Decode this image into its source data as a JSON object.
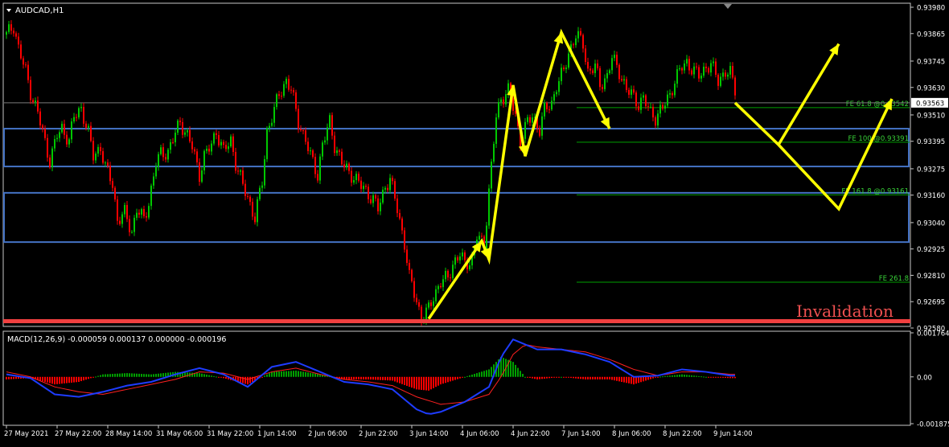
{
  "window": {
    "symbol_label": "AUDCAD,H1"
  },
  "annotations": {
    "invalidation_label": "Invalidation",
    "fib_levels": [
      {
        "label": "FE 61.8 @0.93542",
        "price": 0.93542
      },
      {
        "label": "FE 100 @0.93391",
        "price": 0.93391
      },
      {
        "label": "FE 161.8 @0.93161",
        "price": 0.93161
      },
      {
        "label": "FE 261.8",
        "price": 0.9278
      }
    ],
    "zones": [
      {
        "name": "upper-demand-zone",
        "top": 0.9345,
        "bottom": 0.93285
      },
      {
        "name": "lower-demand-zone",
        "top": 0.9317,
        "bottom": 0.92955
      }
    ],
    "invalidation_price": 0.92615,
    "current_price_label": "0.93563",
    "current_price": 0.93563,
    "colors": {
      "bull": "#00c800",
      "bear": "#ff0000",
      "zone": "#4472c4",
      "projection": "#ffff00",
      "fib": "#00a000",
      "invalidation": "#f04040",
      "macd_line": "#1e3cff",
      "signal_line": "#ff2020"
    }
  },
  "chart_data": [
    {
      "type": "candlestick",
      "symbol": "AUDCAD",
      "timeframe": "H1",
      "ylim": [
        0.9258,
        0.9398
      ],
      "yticks": [
        0.9398,
        0.93865,
        0.93745,
        0.9363,
        0.9351,
        0.93395,
        0.93275,
        0.9316,
        0.9304,
        0.92925,
        0.9281,
        0.92695,
        0.9258
      ],
      "ytick_labels": [
        "0.93980",
        "0.93865",
        "0.93745",
        "0.93630",
        "0.93510",
        "0.93395",
        "0.93275",
        "0.93160",
        "0.93040",
        "0.92925",
        "0.92810",
        "0.92695",
        "0.92580"
      ],
      "close_path": [
        [
          0,
          0.9386
        ],
        [
          3,
          0.939
        ],
        [
          5,
          0.938
        ],
        [
          8,
          0.937
        ],
        [
          10,
          0.9361
        ],
        [
          13,
          0.9352
        ],
        [
          16,
          0.9339
        ],
        [
          18,
          0.9331
        ],
        [
          21,
          0.9342
        ],
        [
          23,
          0.9345
        ],
        [
          26,
          0.934
        ],
        [
          28,
          0.935
        ],
        [
          31,
          0.9354
        ],
        [
          34,
          0.9343
        ],
        [
          36,
          0.9333
        ],
        [
          39,
          0.9337
        ],
        [
          41,
          0.9328
        ],
        [
          44,
          0.9321
        ],
        [
          46,
          0.9305
        ],
        [
          49,
          0.9308
        ],
        [
          52,
          0.93
        ],
        [
          54,
          0.931
        ],
        [
          57,
          0.9305
        ],
        [
          59,
          0.9313
        ],
        [
          62,
          0.933
        ],
        [
          64,
          0.9334
        ],
        [
          67,
          0.9335
        ],
        [
          70,
          0.9343
        ],
        [
          72,
          0.9348
        ],
        [
          75,
          0.9342
        ],
        [
          77,
          0.9337
        ],
        [
          80,
          0.9325
        ],
        [
          82,
          0.9333
        ],
        [
          85,
          0.9338
        ],
        [
          87,
          0.9344
        ],
        [
          90,
          0.9335
        ],
        [
          93,
          0.934
        ],
        [
          95,
          0.933
        ],
        [
          98,
          0.932
        ],
        [
          100,
          0.9315
        ],
        [
          103,
          0.9306
        ],
        [
          106,
          0.9322
        ],
        [
          108,
          0.9344
        ],
        [
          111,
          0.9353
        ],
        [
          113,
          0.936
        ],
        [
          116,
          0.9366
        ],
        [
          118,
          0.9362
        ],
        [
          121,
          0.9348
        ],
        [
          124,
          0.934
        ],
        [
          126,
          0.9333
        ],
        [
          129,
          0.9325
        ],
        [
          131,
          0.9338
        ],
        [
          134,
          0.9348
        ],
        [
          136,
          0.9338
        ],
        [
          139,
          0.933
        ],
        [
          142,
          0.9326
        ],
        [
          144,
          0.9324
        ],
        [
          147,
          0.932
        ],
        [
          149,
          0.9318
        ],
        [
          152,
          0.9314
        ],
        [
          154,
          0.931
        ],
        [
          157,
          0.932
        ],
        [
          159,
          0.9323
        ],
        [
          162,
          0.931
        ],
        [
          165,
          0.9295
        ],
        [
          167,
          0.928
        ],
        [
          170,
          0.927
        ],
        [
          172,
          0.9262
        ],
        [
          175,
          0.9266
        ],
        [
          177,
          0.9272
        ],
        [
          180,
          0.9278
        ],
        [
          183,
          0.928
        ],
        [
          185,
          0.9286
        ],
        [
          188,
          0.929
        ],
        [
          190,
          0.9286
        ],
        [
          193,
          0.9288
        ],
        [
          195,
          0.9298
        ],
        [
          198,
          0.9294
        ],
        [
          200,
          0.9318
        ],
        [
          203,
          0.935
        ],
        [
          205,
          0.9358
        ],
        [
          208,
          0.9362
        ],
        [
          211,
          0.935
        ],
        [
          213,
          0.934
        ],
        [
          216,
          0.9348
        ],
        [
          218,
          0.935
        ],
        [
          221,
          0.9345
        ],
        [
          223,
          0.9353
        ],
        [
          226,
          0.9356
        ],
        [
          228,
          0.9364
        ],
        [
          231,
          0.937
        ],
        [
          233,
          0.9378
        ],
        [
          236,
          0.9386
        ],
        [
          239,
          0.9382
        ],
        [
          241,
          0.937
        ],
        [
          244,
          0.9372
        ],
        [
          246,
          0.9364
        ],
        [
          249,
          0.9368
        ],
        [
          251,
          0.9376
        ],
        [
          254,
          0.937
        ],
        [
          257,
          0.9362
        ],
        [
          259,
          0.936
        ],
        [
          262,
          0.9356
        ],
        [
          264,
          0.9358
        ],
        [
          267,
          0.9352
        ],
        [
          269,
          0.935
        ],
        [
          272,
          0.9354
        ],
        [
          275,
          0.936
        ],
        [
          277,
          0.9366
        ],
        [
          280,
          0.9372
        ],
        [
          282,
          0.9374
        ],
        [
          285,
          0.937
        ],
        [
          287,
          0.9368
        ],
        [
          290,
          0.9372
        ],
        [
          292,
          0.9373
        ],
        [
          295,
          0.9366
        ],
        [
          298,
          0.937
        ],
        [
          300,
          0.9369
        ],
        [
          302,
          0.9362
        ]
      ],
      "projection_path": [
        [
          302,
          0.93563
        ],
        [
          320,
          0.9338
        ],
        [
          345,
          0.931
        ],
        [
          367,
          0.9358
        ]
      ],
      "projection_path_2": [
        [
          320,
          0.9338
        ],
        [
          345,
          0.9382
        ]
      ],
      "impulse_path": [
        [
          175,
          0.9262
        ],
        [
          197,
          0.9296
        ],
        [
          200,
          0.9288
        ],
        [
          210,
          0.9364
        ],
        [
          215,
          0.9333
        ],
        [
          230,
          0.9387
        ],
        [
          250,
          0.9345
        ]
      ],
      "x_tick_labels": [
        "27 May 2021",
        "27 May 22:00",
        "28 May 14:00",
        "31 May 06:00",
        "31 May 22:00",
        "1 Jun 14:00",
        "2 Jun 06:00",
        "2 Jun 22:00",
        "3 Jun 14:00",
        "4 Jun 06:00",
        "4 Jun 22:00",
        "7 Jun 14:00",
        "8 Jun 06:00",
        "8 Jun 22:00",
        "9 Jun 14:00"
      ],
      "x_tick_index": [
        0,
        21,
        42,
        63,
        84,
        105,
        126,
        147,
        168,
        189,
        210,
        231,
        252,
        273,
        294
      ]
    },
    {
      "type": "macd",
      "title": "MACD(12,26,9) -0.000059 0.000137 0.000000 -0.000196",
      "params": [
        12,
        26,
        9
      ],
      "values_shown": [
        -5.9e-05,
        0.000137,
        0.0,
        -0.000196
      ],
      "ylim": [
        -0.001875,
        0.001764
      ],
      "yticks": [
        0.001764,
        0.0,
        -0.001875
      ],
      "ytick_labels": [
        "0.001764",
        "0.00",
        "-0.001875"
      ],
      "macd_path": [
        [
          0,
          0.0001
        ],
        [
          10,
          -5e-05
        ],
        [
          20,
          -0.0007
        ],
        [
          30,
          -0.0008
        ],
        [
          40,
          -0.0006
        ],
        [
          50,
          -0.00035
        ],
        [
          60,
          -0.0002
        ],
        [
          70,
          0.0001
        ],
        [
          80,
          0.00035
        ],
        [
          90,
          0.0001
        ],
        [
          100,
          -0.0004
        ],
        [
          110,
          0.0004
        ],
        [
          120,
          0.0006
        ],
        [
          130,
          0.0002
        ],
        [
          140,
          -0.0002
        ],
        [
          150,
          -0.0003
        ],
        [
          160,
          -0.0005
        ],
        [
          170,
          -0.0013
        ],
        [
          175,
          -0.0015
        ],
        [
          180,
          -0.0014
        ],
        [
          190,
          -0.001
        ],
        [
          200,
          -0.0004
        ],
        [
          205,
          0.0008
        ],
        [
          210,
          0.0015
        ],
        [
          215,
          0.0013
        ],
        [
          220,
          0.0011
        ],
        [
          230,
          0.0011
        ],
        [
          240,
          0.0009
        ],
        [
          250,
          0.0006
        ],
        [
          260,
          0.0
        ],
        [
          270,
          5e-05
        ],
        [
          280,
          0.0003
        ],
        [
          290,
          0.0002
        ],
        [
          300,
          5e-05
        ]
      ],
      "signal_path": [
        [
          0,
          0.0002
        ],
        [
          10,
          0.0
        ],
        [
          20,
          -0.0004
        ],
        [
          30,
          -0.0006
        ],
        [
          40,
          -0.0007
        ],
        [
          50,
          -0.0005
        ],
        [
          60,
          -0.0003
        ],
        [
          70,
          -0.0001
        ],
        [
          80,
          0.0002
        ],
        [
          90,
          0.00015
        ],
        [
          100,
          -0.0001
        ],
        [
          110,
          0.0002
        ],
        [
          120,
          0.00035
        ],
        [
          130,
          0.0001
        ],
        [
          140,
          -0.0001
        ],
        [
          150,
          -0.0002
        ],
        [
          160,
          -0.00035
        ],
        [
          170,
          -0.0008
        ],
        [
          180,
          -0.0011
        ],
        [
          190,
          -0.001
        ],
        [
          200,
          -0.0007
        ],
        [
          205,
          0.0
        ],
        [
          210,
          0.0009
        ],
        [
          215,
          0.0013
        ],
        [
          220,
          0.0012
        ],
        [
          230,
          0.0011
        ],
        [
          240,
          0.001
        ],
        [
          250,
          0.0007
        ],
        [
          260,
          0.0003
        ],
        [
          270,
          5e-05
        ],
        [
          280,
          0.0002
        ],
        [
          290,
          0.0002
        ],
        [
          300,
          0.0001
        ]
      ]
    }
  ]
}
